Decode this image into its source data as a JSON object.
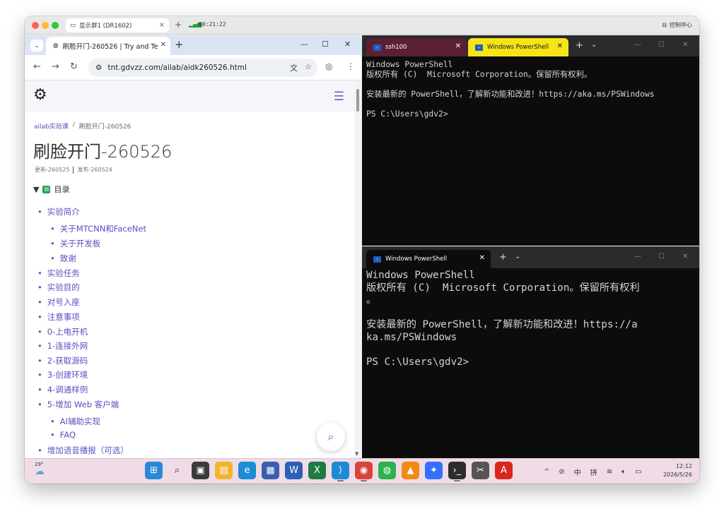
{
  "mac": {
    "tab_title": "显示屏1 (DR1602)",
    "plus": "+",
    "time": "00:21:22",
    "control_center": "控制中心"
  },
  "chrome": {
    "tab_title": "刷脸开门-260526 | Try and Te",
    "url": "tnt.gdvzz.com/ailab/aidk260526.html",
    "new_tab": "+"
  },
  "page": {
    "breadcrumb": [
      "ailab实验课",
      "/",
      "刷脸开门-260526"
    ],
    "title": "刷脸开门-260526",
    "updated": "更新-260525",
    "published": "发布-260524",
    "toc_title": "目录",
    "toc": [
      {
        "label": "实验简介",
        "level": 1
      },
      {
        "label": "关于MTCNN和FaceNet",
        "level": 2
      },
      {
        "label": "关于开发板",
        "level": 2
      },
      {
        "label": "致谢",
        "level": 2
      },
      {
        "label": "实验任务",
        "level": 1
      },
      {
        "label": "实验目的",
        "level": 1
      },
      {
        "label": "对号入座",
        "level": 1
      },
      {
        "label": "注意事项",
        "level": 1
      },
      {
        "label": "0-上电开机",
        "level": 1
      },
      {
        "label": "1-连接外网",
        "level": 1
      },
      {
        "label": "2-获取源码",
        "level": 1
      },
      {
        "label": "3-创建环境",
        "level": 1
      },
      {
        "label": "4-调通样例",
        "level": 1
      },
      {
        "label": "5-增加 Web 客户端",
        "level": 1
      },
      {
        "label": "AI辅助实现",
        "level": 2
      },
      {
        "label": "FAQ",
        "level": 2
      },
      {
        "label": "增加语音播报（可选）",
        "level": 1
      }
    ]
  },
  "terminal_top": {
    "tab1": "ssh100",
    "tab2": "Windows PowerShell",
    "lines": [
      "Windows PowerShell",
      "版权所有 (C)  Microsoft Corporation。保留所有权利。",
      "",
      "安装最新的 PowerShell，了解新功能和改进！https://aka.ms/PSWindows",
      "",
      "PS C:\\Users\\gdv2>"
    ]
  },
  "terminal_bottom": {
    "tab1": "Windows PowerShell",
    "lines": [
      "Windows PowerShell",
      "版权所有 (C)  Microsoft Corporation。保留所有权利",
      "。",
      "",
      "安装最新的 PowerShell，了解新功能和改进！https://a",
      "ka.ms/PSWindows",
      "",
      "PS C:\\Users\\gdv2>"
    ]
  },
  "taskbar": {
    "temperature": "29°",
    "ime_mode": "中",
    "ime": "拼",
    "time": "12:12",
    "date": "2026/5/26",
    "apps": [
      {
        "icon": "windows-start-icon",
        "glyph": "⊞",
        "color": "#2b88d8"
      },
      {
        "icon": "search-icon",
        "glyph": "⌕",
        "color": "transparent"
      },
      {
        "icon": "task-view-icon",
        "glyph": "▣",
        "color": "#3a3a3a"
      },
      {
        "icon": "file-explorer-icon",
        "glyph": "▤",
        "color": "#f2b531"
      },
      {
        "icon": "edge-icon",
        "glyph": "e",
        "color": "#1d8bd6"
      },
      {
        "icon": "store-icon",
        "glyph": "▦",
        "color": "#3a5fb0"
      },
      {
        "icon": "word-icon",
        "glyph": "W",
        "color": "#2b5fb8"
      },
      {
        "icon": "excel-icon",
        "glyph": "X",
        "color": "#1f7a43"
      },
      {
        "icon": "vscode-icon",
        "glyph": "⟩",
        "color": "#1f8ad4"
      },
      {
        "icon": "chrome-icon",
        "glyph": "◉",
        "color": "#d9443a"
      },
      {
        "icon": "wechat-icon",
        "glyph": "◍",
        "color": "#2bb24c"
      },
      {
        "icon": "vlc-icon",
        "glyph": "▲",
        "color": "#f08a16"
      },
      {
        "icon": "feishu-icon",
        "glyph": "✦",
        "color": "#3370ff"
      },
      {
        "icon": "terminal-icon",
        "glyph": "›_",
        "color": "#2d2d2d"
      },
      {
        "icon": "snipping-tool-icon",
        "glyph": "✂",
        "color": "#555555"
      },
      {
        "icon": "acrobat-icon",
        "glyph": "A",
        "color": "#d8261d"
      }
    ]
  }
}
